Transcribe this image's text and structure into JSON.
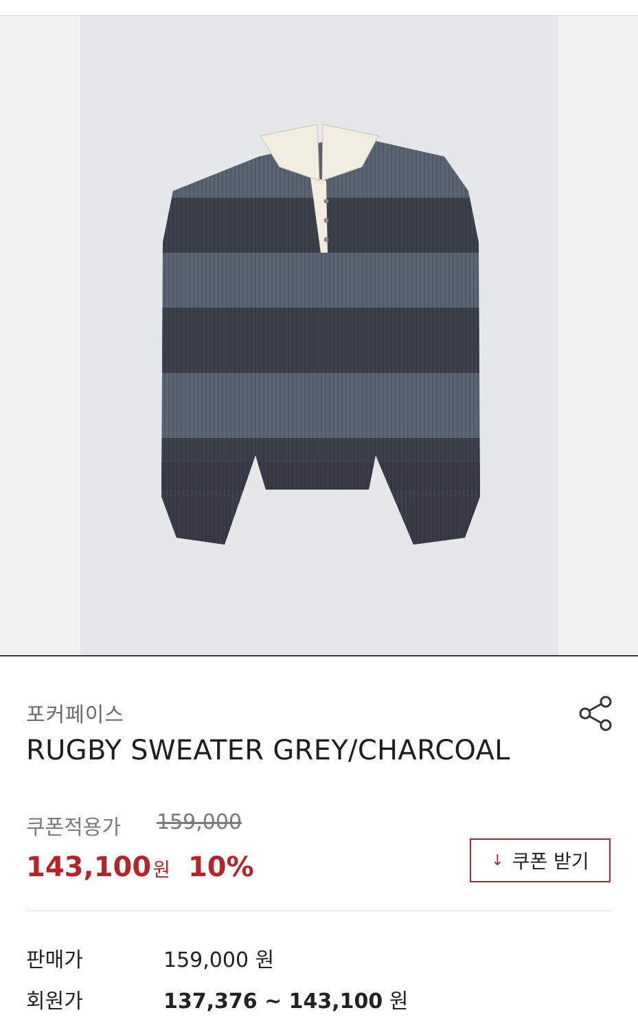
{
  "product": {
    "brand": "포커페이스",
    "title": "RUGBY SWEATER GREY/CHARCOAL",
    "image_alt": "Grey and charcoal striped rugby knit sweater with cream collar"
  },
  "pricing": {
    "coupon_label": "쿠폰적용가",
    "original_price": "159,000",
    "sale_price": "143,100",
    "sale_unit": "원",
    "discount": "10%",
    "coupon_button": "쿠폰 받기"
  },
  "details": {
    "rows": [
      {
        "label": "판매가",
        "value": "159,000",
        "unit": " 원"
      },
      {
        "label": "회원가",
        "value": "137,376 ~ 143,100",
        "unit": " 원"
      }
    ]
  },
  "colors": {
    "accent": "#b5242a",
    "stripe_light": "#5b6473",
    "stripe_dark": "#3d414c",
    "collar": "#f1ede0"
  },
  "icons": {
    "share": "share-icon",
    "download": "download-arrow-icon"
  }
}
